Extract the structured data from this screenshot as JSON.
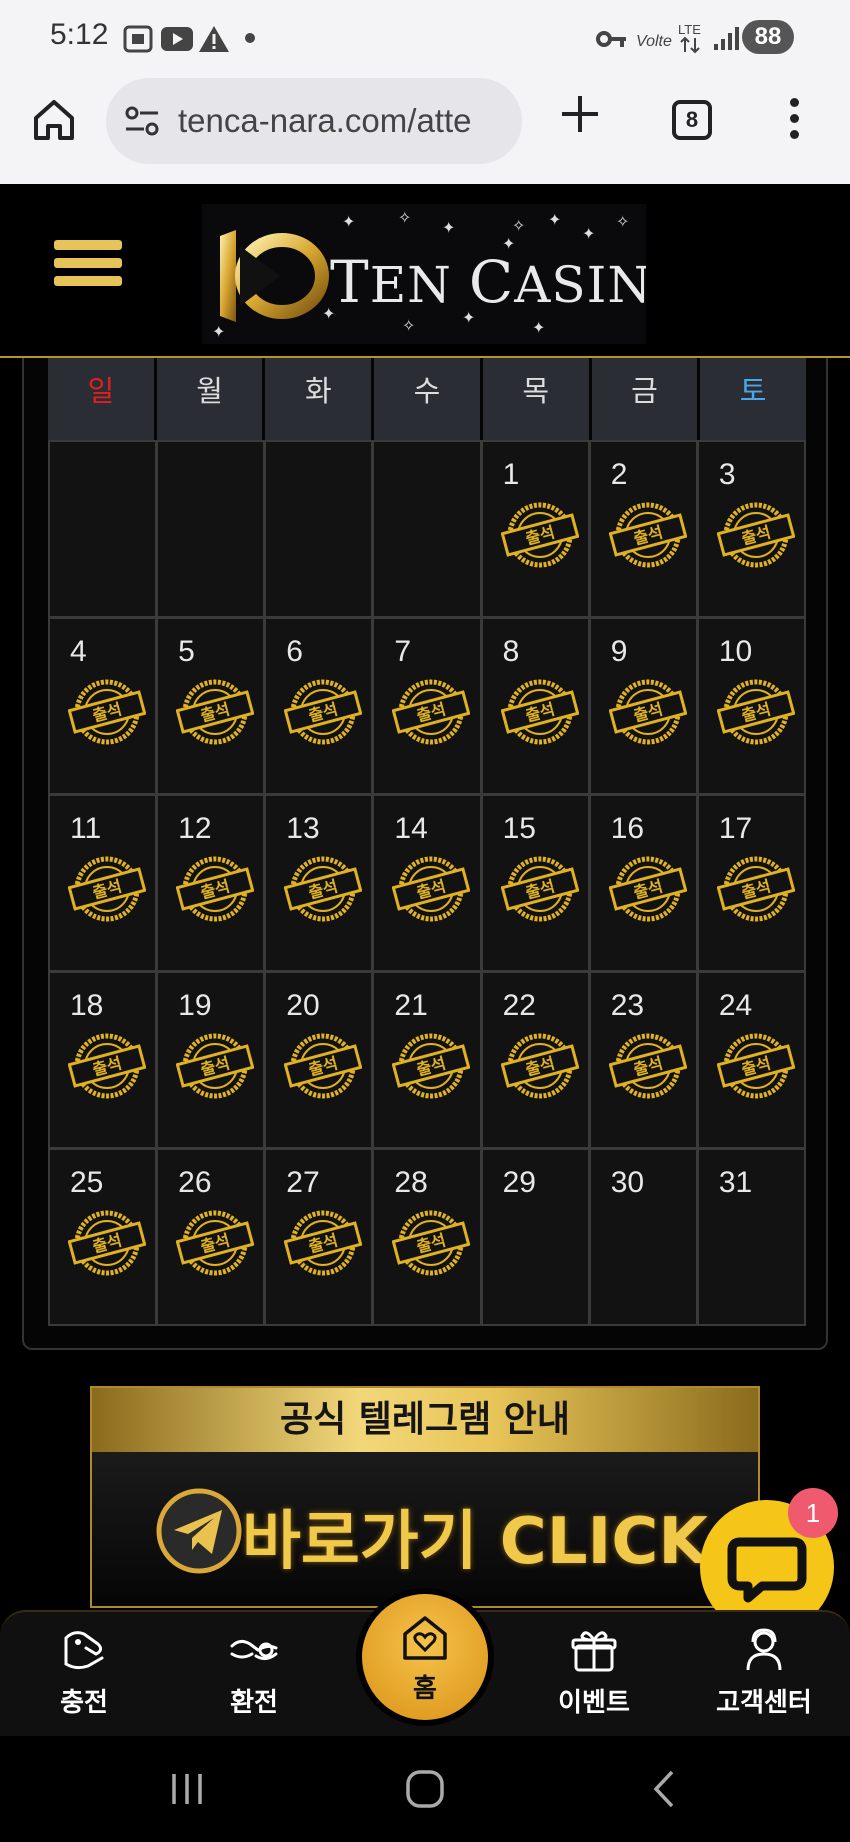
{
  "status_bar": {
    "time": "5:12",
    "network": "LTE",
    "battery": "88",
    "icons": [
      "screenshot-icon",
      "youtube-icon",
      "warning-icon",
      "dot-icon",
      "key-icon",
      "volte-icon",
      "lte-icon",
      "signal-icon",
      "battery-icon"
    ]
  },
  "browser": {
    "url": "tenca-nara.com/atte",
    "tab_count": "8"
  },
  "header": {
    "logo_text_part1": "T",
    "logo_text_part2": "EN ",
    "logo_text_part3": "C",
    "logo_text_part4": "ASINO"
  },
  "calendar": {
    "weekdays": [
      "일",
      "월",
      "화",
      "수",
      "목",
      "금",
      "토"
    ],
    "stamp_label": "출석",
    "stamp_color": "#e0b221",
    "weeks": [
      [
        "",
        "",
        "",
        "",
        "1",
        "2",
        "3"
      ],
      [
        "4",
        "5",
        "6",
        "7",
        "8",
        "9",
        "10"
      ],
      [
        "11",
        "12",
        "13",
        "14",
        "15",
        "16",
        "17"
      ],
      [
        "18",
        "19",
        "20",
        "21",
        "22",
        "23",
        "24"
      ],
      [
        "25",
        "26",
        "27",
        "28",
        "29",
        "30",
        "31"
      ]
    ],
    "attended_through": 28
  },
  "banner": {
    "title": "공식 텔레그램 안내",
    "cta": "바로가기 CLICK"
  },
  "chat": {
    "badge": "1"
  },
  "bottom_nav": {
    "items": [
      {
        "label": "충전",
        "icon": "deposit-icon"
      },
      {
        "label": "환전",
        "icon": "withdraw-icon"
      },
      {
        "label": "홈",
        "icon": "home-heart-icon"
      },
      {
        "label": "이벤트",
        "icon": "gift-icon"
      },
      {
        "label": "고객센터",
        "icon": "support-icon"
      }
    ]
  },
  "colors": {
    "gold": "#e7c45a",
    "sunday": "#e02020",
    "saturday": "#4aa8e8"
  }
}
